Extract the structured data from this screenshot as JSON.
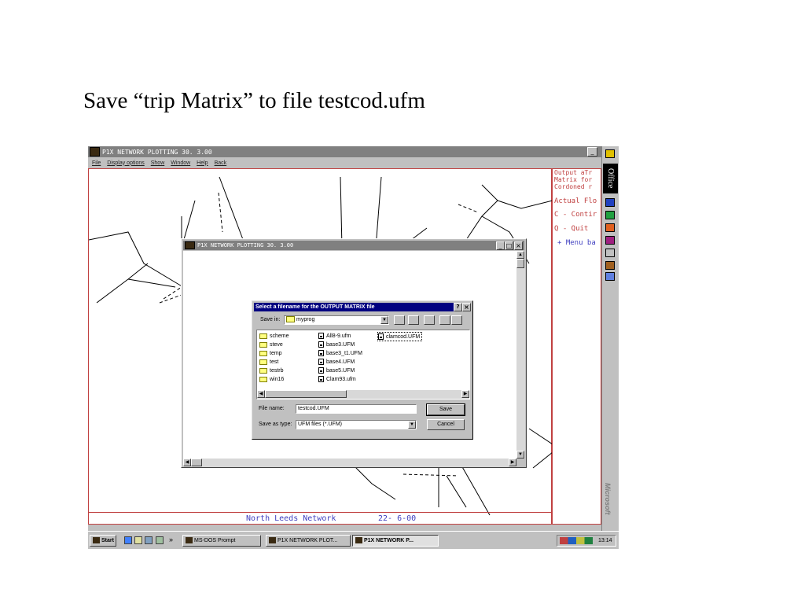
{
  "slide": {
    "title": "Save “trip Matrix” to file testcod.ufm"
  },
  "app": {
    "title": "P1X    NETWORK PLOTTING  30. 3.00",
    "menu": [
      "File",
      "Display options",
      "Show",
      "Window",
      "Help",
      "Back"
    ],
    "side_lines": [
      "Output aTr",
      "Matrix for",
      "Cordoned r",
      "Actual Flo",
      "C - Contir",
      "Q - Quit",
      "+ Menu ba"
    ],
    "status": {
      "network": "North Leeds Network",
      "date": "22- 6-00"
    },
    "colors": {
      "panel_red": "#c04040",
      "menu_blue": "#4040c0",
      "title_navy": "#000080"
    }
  },
  "inner_window": {
    "title": "P1X    NETWORK PLOTTING  30. 3.00"
  },
  "dialog": {
    "title": "Select a filename for the OUTPUT  MATRIX  file",
    "save_in_label": "Save in:",
    "save_in_value": "myprog",
    "folders": [
      "scheme",
      "steve",
      "temp",
      "test",
      "testrb",
      "win16"
    ],
    "files_col2": [
      "All8-9.ufm",
      "base3.UFM",
      "base3_t1.UFM",
      "base4.UFM",
      "base5.UFM",
      "Clam93.ufm"
    ],
    "files_col3": [
      "clamcod.UFM"
    ],
    "file_name_label": "File name:",
    "file_name_value": "testcod.UFM",
    "type_label": "Save as type:",
    "type_value": "UFM files (*.UFM)",
    "save_button": "Save",
    "cancel_button": "Cancel",
    "help_glyph": "?",
    "close_glyph": "×"
  },
  "office_bar": {
    "label": "Office",
    "vendor": "Microsoft"
  },
  "taskbar": {
    "start": "Start",
    "more": "»",
    "tasks": [
      "MS-DOS Prompt",
      "P1X    NETWORK PLOT...",
      "P1X    NETWORK P..."
    ],
    "clock": "13:14"
  }
}
